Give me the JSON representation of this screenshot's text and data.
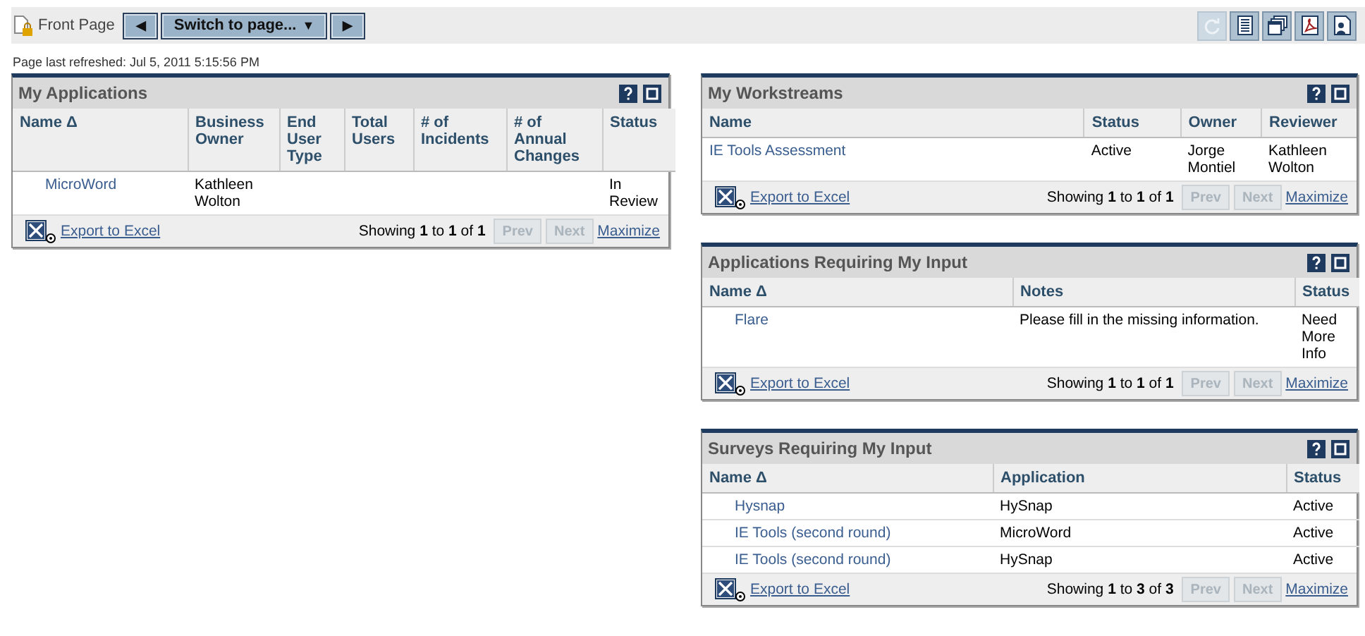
{
  "toolbar": {
    "page_title": "Front Page",
    "prev_label": "◀",
    "switch_label": "Switch to page...",
    "switch_caret": "▼",
    "next_label": "▶",
    "tools": [
      {
        "kind": "refresh",
        "disabled": true
      },
      {
        "kind": "list",
        "disabled": false
      },
      {
        "kind": "windows",
        "disabled": false
      },
      {
        "kind": "pdf",
        "disabled": false
      },
      {
        "kind": "user-page",
        "disabled": false
      }
    ]
  },
  "refreshed": "Page last refreshed: Jul 5, 2011 5:15:56 PM",
  "columns": [
    {
      "portlets": [
        {
          "title": "My Applications",
          "columns": [
            "Name Δ",
            "Business Owner",
            "End User Type",
            "Total Users",
            "# of Incidents",
            "# of Annual Changes",
            "Status"
          ],
          "rows": [
            [
              "MicroWord",
              "Kathleen Wolton",
              "",
              "",
              "",
              "",
              "In Review"
            ]
          ],
          "export": "Export to Excel",
          "showing": "Showing **1** to **1** of **1**",
          "prev": {
            "label": "Prev",
            "disabled": true
          },
          "next": {
            "label": "Next",
            "disabled": true
          },
          "maximize": "Maximize"
        }
      ]
    },
    {
      "portlets": [
        {
          "title": "My Workstreams",
          "columns": [
            "Name",
            "Status",
            "Owner",
            "Reviewer"
          ],
          "rows": [
            [
              "IE Tools Assessment",
              "Active",
              "Jorge Montiel",
              "Kathleen Wolton"
            ]
          ],
          "export": "Export to Excel",
          "showing": "Showing **1** to **1** of **1**",
          "prev": {
            "label": "Prev",
            "disabled": true
          },
          "next": {
            "label": "Next",
            "disabled": true
          },
          "maximize": "Maximize"
        },
        {
          "title": "Applications Requiring My Input",
          "columns": [
            "Name Δ",
            "Notes",
            "Status"
          ],
          "rows": [
            [
              "Flare",
              "Please fill in the missing information.",
              "Need More Info"
            ]
          ],
          "export": "Export to Excel",
          "showing": "Showing **1** to **1** of **1**",
          "prev": {
            "label": "Prev",
            "disabled": true
          },
          "next": {
            "label": "Next",
            "disabled": true
          },
          "maximize": "Maximize"
        },
        {
          "title": "Surveys Requiring My Input",
          "columns": [
            "Name Δ",
            "Application",
            "Status"
          ],
          "rows": [
            [
              "Hysnap",
              "HySnap",
              "Active"
            ],
            [
              "IE Tools (second round)",
              "MicroWord",
              "Active"
            ],
            [
              "IE Tools (second round)",
              "HySnap",
              "Active"
            ]
          ],
          "export": "Export to Excel",
          "showing": "Showing **1** to **3** of **3**",
          "prev": {
            "label": "Prev",
            "disabled": true
          },
          "next": {
            "label": "Next",
            "disabled": true
          },
          "maximize": "Maximize"
        }
      ]
    }
  ]
}
